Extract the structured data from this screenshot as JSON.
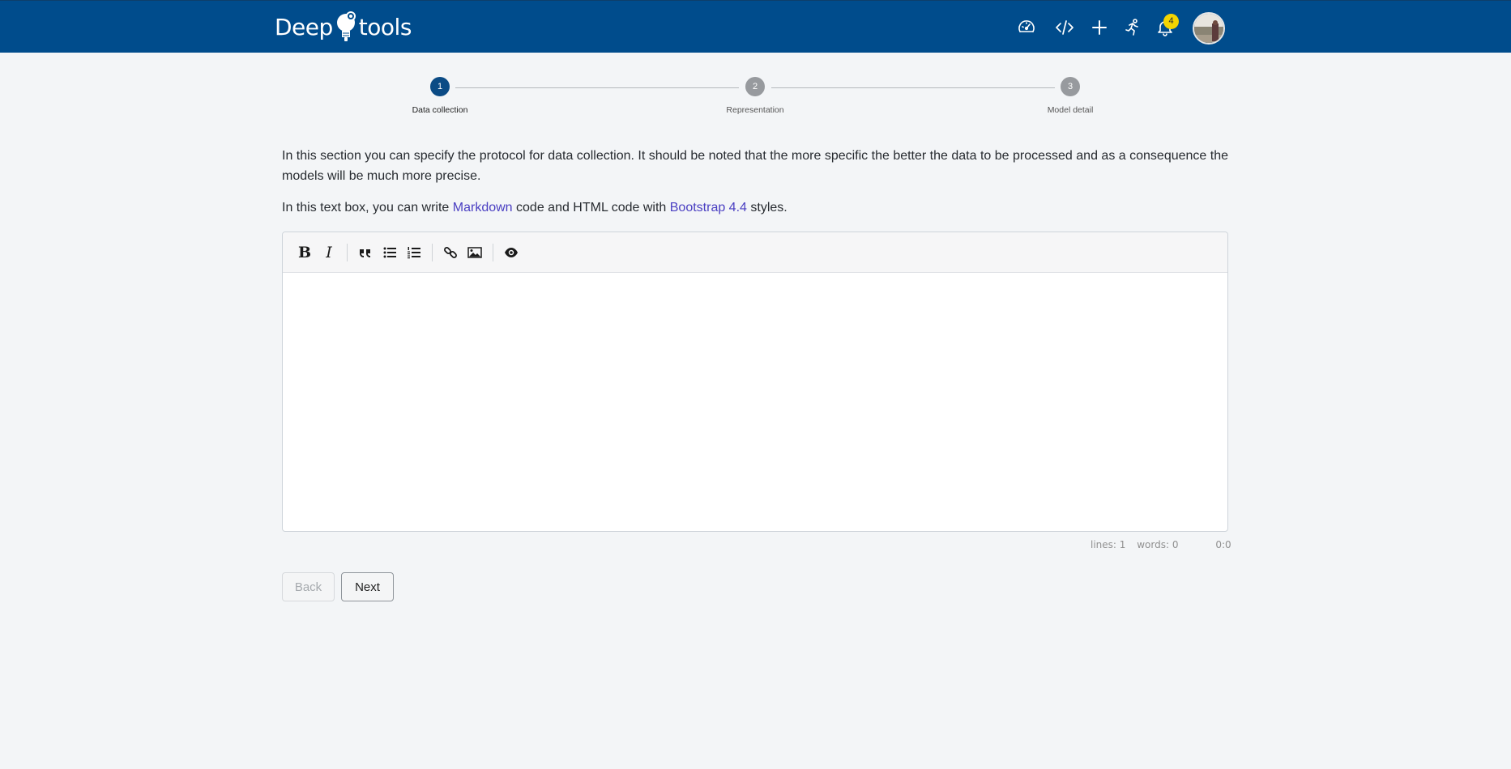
{
  "header": {
    "logo_left": "Deep",
    "logo_right": "tools",
    "notification_count": "4",
    "nav_icons": [
      "dashboard-gauge-icon",
      "code-icon",
      "plus-icon",
      "running-person-icon",
      "bell-icon"
    ]
  },
  "stepper": {
    "steps": [
      {
        "number": "1",
        "label": "Data collection",
        "state": "active"
      },
      {
        "number": "2",
        "label": "Representation",
        "state": "inactive"
      },
      {
        "number": "3",
        "label": "Model detail",
        "state": "inactive"
      }
    ]
  },
  "content": {
    "intro": "In this section you can specify the protocol for data collection. It should be noted that the more specific the better the data to be processed and as a consequence the models will be much more precise.",
    "note_prefix": "In this text box, you can write ",
    "markdown_link": "Markdown",
    "note_middle": " code and HTML code with ",
    "bootstrap_link": "Bootstrap 4.4",
    "note_suffix": " styles."
  },
  "editor": {
    "toolbar": {
      "bold": "B",
      "italic": "I",
      "tools": [
        "bold-icon",
        "italic-icon",
        "quote-icon",
        "unordered-list-icon",
        "ordered-list-icon",
        "link-icon",
        "image-icon",
        "preview-eye-icon"
      ]
    },
    "value": "",
    "status": {
      "lines": "lines: 1",
      "words": "words: 0",
      "cursor": "0:0"
    }
  },
  "actions": {
    "back_label": "Back",
    "next_label": "Next"
  },
  "colors": {
    "header_bg": "#004c8c",
    "step_active": "#0b4b85",
    "step_inactive": "#979a9e",
    "link": "#4a3fc2",
    "badge": "#f3d400"
  }
}
